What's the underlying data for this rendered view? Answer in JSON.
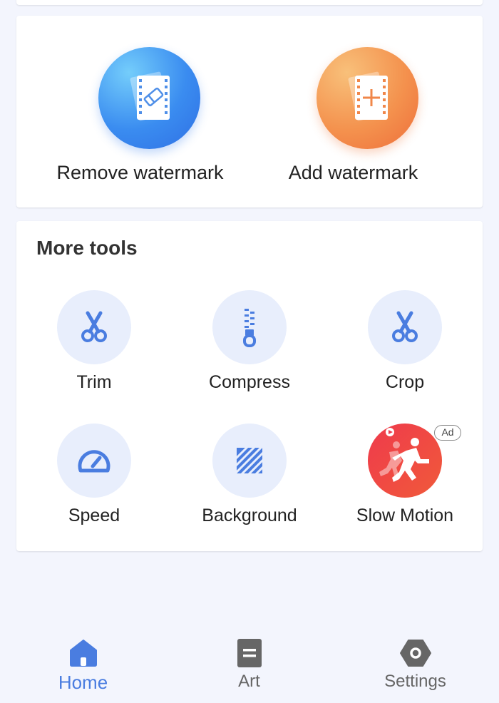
{
  "watermark": {
    "remove_label": "Remove watermark",
    "add_label": "Add watermark"
  },
  "tools": {
    "title": "More tools",
    "items": [
      {
        "label": "Trim",
        "icon": "scissors-icon"
      },
      {
        "label": "Compress",
        "icon": "zipper-icon"
      },
      {
        "label": "Crop",
        "icon": "scissors-icon"
      },
      {
        "label": "Speed",
        "icon": "speedometer-icon"
      },
      {
        "label": "Background",
        "icon": "striped-square-icon"
      },
      {
        "label": "Slow Motion",
        "icon": "runner-icon"
      }
    ],
    "ad_badge": "Ad"
  },
  "nav": {
    "items": [
      {
        "label": "Home",
        "icon": "home-icon",
        "active": true
      },
      {
        "label": "Art",
        "icon": "document-icon",
        "active": false
      },
      {
        "label": "Settings",
        "icon": "hexagon-gear-icon",
        "active": false
      }
    ]
  },
  "colors": {
    "accent": "#4a7de0",
    "background": "#f3f5fd",
    "tool_circle": "#e8eefc",
    "nav_inactive": "#666666"
  }
}
